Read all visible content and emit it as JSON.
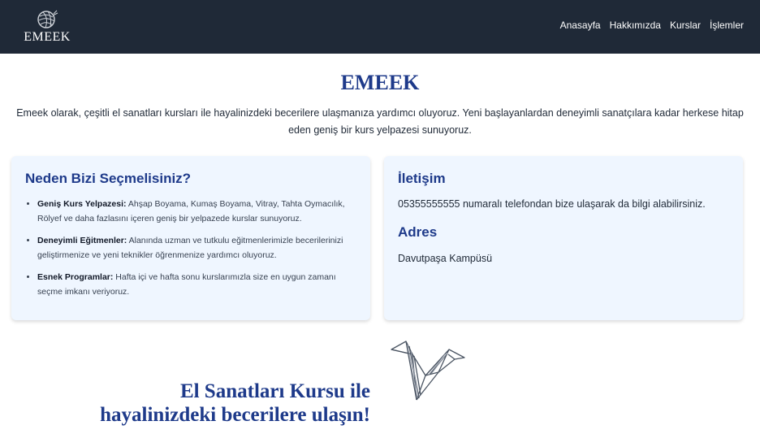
{
  "brand": {
    "name": "EMEEK",
    "logo_icon": "yarn-ball-icon"
  },
  "nav": {
    "items": [
      {
        "label": "Anasayfa"
      },
      {
        "label": "Hakkımızda"
      },
      {
        "label": "Kurslar"
      },
      {
        "label": "İşlemler"
      }
    ]
  },
  "hero": {
    "title": "EMEEK",
    "intro": "Emeek olarak, çeşitli el sanatları kursları ile hayalinizdeki becerilere ulaşmanıza yardımcı oluyoruz. Yeni başlayanlardan deneyimli sanatçılara kadar herkese hitap eden geniş bir kurs yelpazesi sunuyoruz."
  },
  "why": {
    "title": "Neden Bizi Seçmelisiniz?",
    "items": [
      {
        "bold": "Geniş Kurs Yelpazesi:",
        "text": " Ahşap Boyama, Kumaş Boyama, Vitray, Tahta Oymacılık, Rölyef ve daha fazlasını içeren geniş bir yelpazede kurslar sunuyoruz."
      },
      {
        "bold": "Deneyimli Eğitmenler:",
        "text": " Alanında uzman ve tutkulu eğitmenlerimizle becerilerinizi geliştirmenize ve yeni teknikler öğrenmenize yardımcı oluyoruz."
      },
      {
        "bold": "Esnek Programlar:",
        "text": " Hafta içi ve hafta sonu kurslarımızla size en uygun zamanı seçme imkanı veriyoruz."
      }
    ]
  },
  "contact": {
    "title": "İletişim",
    "text": "05355555555 numaralı telefondan bize ulaşarak da bilgi alabilirsiniz."
  },
  "address": {
    "title": "Adres",
    "text": "Davutpaşa Kampüsü"
  },
  "tagline": {
    "line1": "El Sanatları Kursu ile",
    "line2": "hayalinizdeki becerilere ulaşın!"
  },
  "decoration": {
    "icon": "origami-bird-icon"
  },
  "colors": {
    "navbar": "#1f2937",
    "accent": "#1e3a8a",
    "card": "#eff6ff"
  }
}
